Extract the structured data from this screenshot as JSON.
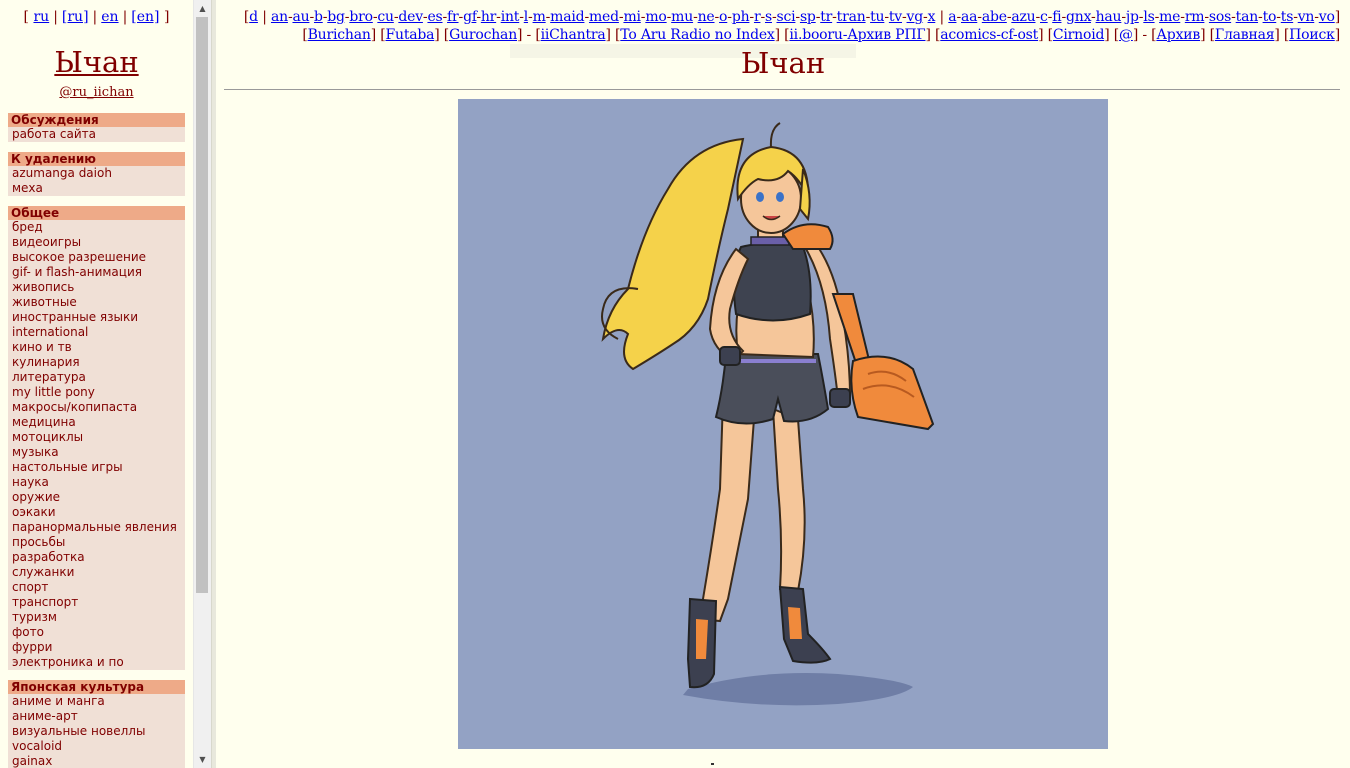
{
  "sidebar": {
    "lang_links": [
      "ru",
      "[ru]",
      "en",
      "[en]"
    ],
    "title": "Ычан",
    "handle": "@ru_iichan",
    "sections": [
      {
        "title": "Обсуждения",
        "items": [
          "работа сайта"
        ]
      },
      {
        "title": "К удалению",
        "items": [
          "azumanga daioh",
          "меха"
        ]
      },
      {
        "title": "Общее",
        "items": [
          "бред",
          "видеоигры",
          "высокое разрешение",
          "gif- и flash-анимация",
          "живопись",
          "животные",
          "иностранные языки",
          "international",
          "кино и тв",
          "кулинария",
          "литература",
          "my little pony",
          "макросы/копипаста",
          "медицина",
          "мотоциклы",
          "музыка",
          "настольные игры",
          "наука",
          "оружие",
          "оэкаки",
          "паранормальные явления",
          "просьбы",
          "разработка",
          "служанки",
          "спорт",
          "транспорт",
          "туризм",
          "фото",
          "фурри",
          "электроника и по"
        ]
      },
      {
        "title": "Японская культура",
        "items": [
          "аниме и манга",
          "аниме-арт",
          "визуальные новеллы",
          "vocaloid",
          "gainax"
        ]
      }
    ]
  },
  "nav": {
    "row1_a": [
      "d"
    ],
    "row1_b": [
      "an",
      "au",
      "b",
      "bg",
      "bro",
      "cu",
      "dev",
      "es",
      "fr",
      "gf",
      "hr",
      "int",
      "l",
      "m",
      "maid",
      "med",
      "mi",
      "mo",
      "mu",
      "ne",
      "o",
      "ph",
      "r",
      "s",
      "sci",
      "sp",
      "tr",
      "tran",
      "tu",
      "tv",
      "vg",
      "x"
    ],
    "row1_c": [
      "a",
      "aa",
      "abe",
      "azu",
      "c",
      "fi",
      "gnx",
      "hau",
      "jp",
      "ls",
      "me",
      "rm",
      "sos",
      "tan",
      "to",
      "ts",
      "vn",
      "vo"
    ],
    "row2_a": [
      "Burichan",
      "Futaba",
      "Gurochan"
    ],
    "row2_b": [
      "iiChantra"
    ],
    "row2_c": [
      "To Aru Radio no Index"
    ],
    "row2_d": [
      "ii.booru-Архив РПГ"
    ],
    "row2_e": [
      "acomics-cf-ost"
    ],
    "row2_f": [
      "Cirnoid"
    ],
    "row2_g": [
      "@"
    ],
    "row2_h": [
      "Архив"
    ],
    "row2_i": [
      "Главная"
    ],
    "row2_j": [
      "Поиск"
    ]
  },
  "board_title": "Ычан",
  "scroll": {
    "up_icon": "▲",
    "down_icon": "▼"
  },
  "colors": {
    "accent": "#800000",
    "section_header": "#eeaa88",
    "section_bg": "#f0e0d6",
    "page_bg": "#ffffee",
    "banner_bg": "#93a2c4"
  }
}
